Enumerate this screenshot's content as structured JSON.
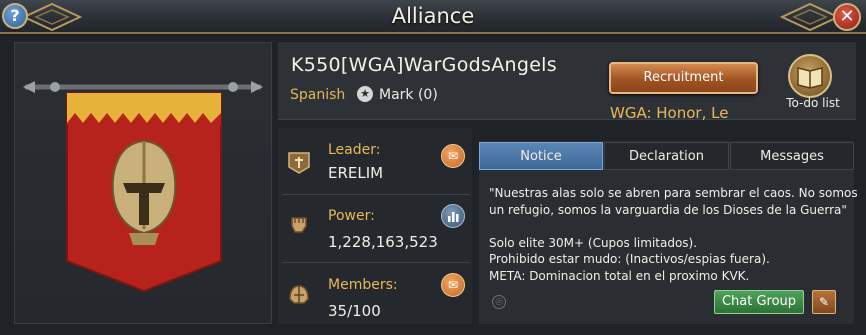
{
  "window": {
    "title": "Alliance",
    "help_glyph": "?",
    "close_glyph": "✕"
  },
  "header": {
    "alliance_name": "K550[WGA]WarGodsAngels",
    "language": "Spanish",
    "mark_label": "Mark (0)",
    "tagline": "WGA: Honor, Le",
    "recruitment_label": "Recruitment",
    "todo_label": "To-do list"
  },
  "stats": {
    "leader_label": "Leader:",
    "leader_value": "ERELIM",
    "power_label": "Power:",
    "power_value": "1,228,163,523",
    "members_label": "Members:",
    "members_value": "35/100"
  },
  "tabs": [
    "Notice",
    "Declaration",
    "Messages"
  ],
  "active_tab": "Notice",
  "notice": {
    "line1": "\"Nuestras alas solo se abren para sembrar el caos. No somos",
    "line2": "un refugio, somos la varguardia de los Dioses de la Guerra\"",
    "line3": "Solo elite 30M+ (Cupos limitados).",
    "line4": "Prohibido estar mudo: (Inactivos/espias fuera).",
    "line5": "META: Dominacion total en el proximo KVK."
  },
  "chat_group_label": "Chat Group",
  "icons": {
    "help": "help-icon",
    "close": "close-icon",
    "banner": "alliance-banner-icon",
    "mark": "star-icon",
    "todo": "book-icon",
    "leader": "leader-emblem-icon",
    "power": "fist-icon",
    "members": "helmet-icon",
    "mail": "mail-icon",
    "chart": "bar-chart-icon",
    "edit": "pencil-icon"
  },
  "colors": {
    "accent_gold": "#e8b75a",
    "banner_red": "#b5231c",
    "active_tab": "#4a76a8",
    "chat_green": "#3c8a45",
    "recruit_orange": "#a55a27"
  }
}
